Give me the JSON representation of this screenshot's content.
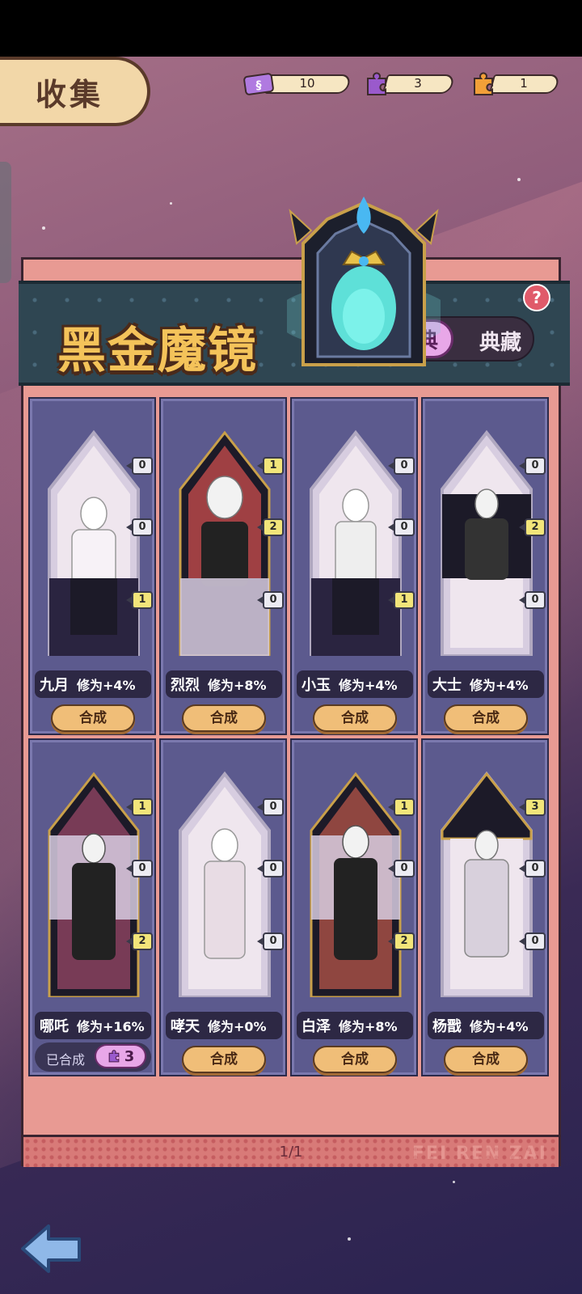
{
  "header": {
    "title": "收集"
  },
  "currencies": [
    {
      "icon": "ticket-icon",
      "value": "10",
      "color": "#a86ad8"
    },
    {
      "icon": "purple-puzzle-icon",
      "value": "3",
      "color": "#9a5acc"
    },
    {
      "icon": "orange-puzzle-icon",
      "value": "1",
      "color": "#f2a038"
    }
  ],
  "collection": {
    "title": "黑金魔镜",
    "mode_active": "经典",
    "mode_inactive": "典藏",
    "help": "?",
    "page": "1/1",
    "watermark": "FEI REN ZAI"
  },
  "cards": [
    {
      "name": "九月",
      "bonus": "修为+4%",
      "pieces": [
        "0",
        "0",
        "1"
      ],
      "action": "合成",
      "owned": false
    },
    {
      "name": "烈烈",
      "bonus": "修为+8%",
      "pieces": [
        "1",
        "2",
        "0"
      ],
      "action": "合成",
      "owned": false
    },
    {
      "name": "小玉",
      "bonus": "修为+4%",
      "pieces": [
        "0",
        "0",
        "1"
      ],
      "action": "合成",
      "owned": false
    },
    {
      "name": "大士",
      "bonus": "修为+4%",
      "pieces": [
        "0",
        "2",
        "0"
      ],
      "action": "合成",
      "owned": false
    },
    {
      "name": "哪吒",
      "bonus": "修为+16%",
      "pieces": [
        "1",
        "0",
        "2"
      ],
      "action": "已合成",
      "owned": true,
      "composed_count": "3"
    },
    {
      "name": "哮天",
      "bonus": "修为+0%",
      "pieces": [
        "0",
        "0",
        "0"
      ],
      "action": "合成",
      "owned": false
    },
    {
      "name": "白泽",
      "bonus": "修为+8%",
      "pieces": [
        "1",
        "0",
        "2"
      ],
      "action": "合成",
      "owned": false
    },
    {
      "name": "杨戬",
      "bonus": "修为+4%",
      "pieces": [
        "3",
        "0",
        "0"
      ],
      "action": "合成",
      "owned": false
    }
  ]
}
